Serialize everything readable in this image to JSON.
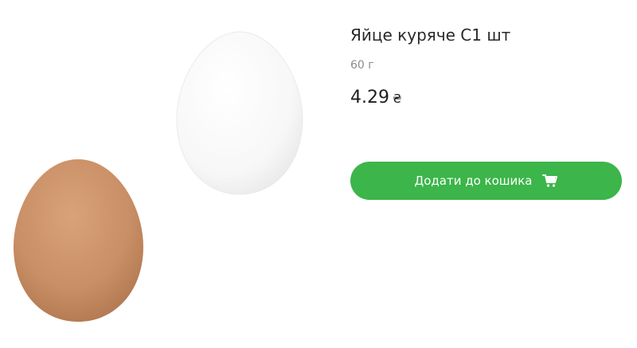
{
  "product": {
    "title": "Яйце куряче С1 шт",
    "weight": "60 г",
    "price": "4.29",
    "currency": "₴",
    "image_icon": "eggs-image"
  },
  "actions": {
    "add_to_cart_label": "Додати до кошика",
    "add_to_cart_icon": "cart-icon"
  },
  "colors": {
    "accent": "#3cb54a",
    "brown_egg": "#c98f66",
    "white_egg": "#f7f7f7",
    "text": "#2a2a2a",
    "muted": "#8c8c8c"
  }
}
